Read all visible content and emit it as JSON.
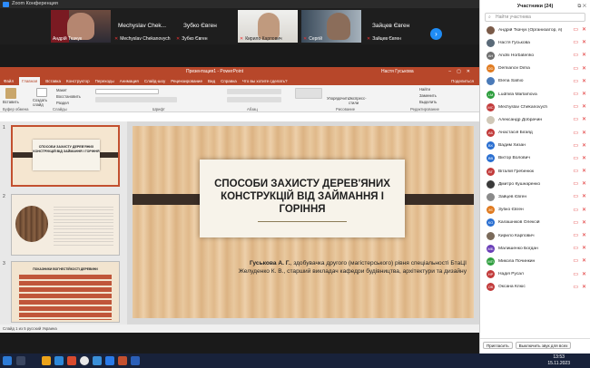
{
  "zoom": {
    "window_title": "Zoom Конференция",
    "tiles": [
      {
        "name": "Андрій Ткачук",
        "muted": false
      },
      {
        "name": "Mechyslav Chekanovych",
        "muted": true,
        "big_name": "Mechyslav  Chek..."
      },
      {
        "name": "Зубко Євген",
        "muted": true,
        "big_name": "Зубко Євген"
      },
      {
        "name": "Кирило Карпович",
        "muted": true
      },
      {
        "name": "Сергій",
        "muted": true
      },
      {
        "name": "Зайцев Євген",
        "muted": true,
        "big_name": "Зайцев Євген"
      }
    ]
  },
  "powerpoint": {
    "title_center": "Презентация1 - PowerPoint",
    "user": "Настя Гуськова",
    "tabs": [
      "Файл",
      "Главная",
      "Вставка",
      "Конструктор",
      "Переходы",
      "Анимация",
      "Слайд-шоу",
      "Рецензирование",
      "Вид",
      "Справка",
      "Что вы хотите сделать?"
    ],
    "active_tab": "Главная",
    "share": "Поделиться",
    "ribbon_groups": [
      "Буфер обмена",
      "Слайды",
      "Шрифт",
      "Абзац",
      "Рисование",
      "Редактирование"
    ],
    "ribbon_items": {
      "paste": "Вставить",
      "create_slide": "Создать слайд",
      "layout": "Макет",
      "reset": "Восстановить",
      "section": "Раздел",
      "arrange": "Упорядочить",
      "quick_styles": "Экспресс-стили",
      "find": "Найти",
      "replace": "Заменить",
      "select": "Выделить"
    },
    "slide": {
      "title": "СПОСОБИ ЗАХИСТУ ДЕРЕВ'ЯНИХ КОНСТРУКЦІЙ ВІД ЗАЙМАННЯ І ГОРІННЯ",
      "author_line1_bold": "Гуськова А. Г.",
      "author_line1_rest": ", здобувачка другого (магістерського) рівня спеціальності БтаЦІ",
      "author_line2": "Желуденко К. В., старший викладач кафедри будівництва, архітектури та дизайну"
    },
    "thumbs": [
      {
        "num": "1",
        "title": "СПОСОБИ ЗАХИСТУ ДЕРЕВ'ЯНИХ КОНСТРУКЦІЙ ВІД ЗАЙМАННЯ І ГОРІННЯ"
      },
      {
        "num": "2"
      },
      {
        "num": "3",
        "title": "ПОКАЗНИКИ ВОГНЕСТІЙКОСТІ ДЕРЕВИНИ"
      }
    ],
    "status": "Слайд 1 из 5    русский Украина"
  },
  "participants": {
    "header": "Участники (24)",
    "search_placeholder": "Найти участника",
    "list": [
      {
        "name": "Андрій Ткачук (Организатор, я)",
        "initials": "",
        "color": "#7a5a48"
      },
      {
        "name": "Настя Гуськова",
        "initials": "",
        "color": "#5a6a78"
      },
      {
        "name": "Andrii Horbatenko",
        "initials": "AH",
        "color": "#6e6e6e"
      },
      {
        "name": "Demianov Dima",
        "initials": "DD",
        "color": "#e07a1f"
      },
      {
        "name": "Elena Salnio",
        "initials": "",
        "color": "#4a7ab8"
      },
      {
        "name": "Ludmila Marlamova",
        "initials": "LM",
        "color": "#2e9e3e"
      },
      {
        "name": "Mechyslav Chekanovych",
        "initials": "MC",
        "color": "#c23b3b"
      },
      {
        "name": "Александр Добрачин",
        "initials": "",
        "color": "#d0c8b8"
      },
      {
        "name": "Анастасія Бігаяд",
        "initials": "АБ",
        "color": "#c23b3b"
      },
      {
        "name": "Вадим Хизан",
        "initials": "ВХ",
        "color": "#2a6fd1"
      },
      {
        "name": "Віктор Волович",
        "initials": "ВВ",
        "color": "#2a6fd1"
      },
      {
        "name": "Віталій Гребенюк",
        "initials": "ВГ",
        "color": "#c23b3b"
      },
      {
        "name": "Дмитро Кушнаренко",
        "initials": "",
        "color": "#3a3a3a"
      },
      {
        "name": "Зайцев Євген",
        "initials": "",
        "color": "#8a8a8a"
      },
      {
        "name": "Зубко Євген",
        "initials": "ЗЄ",
        "color": "#e07a1f"
      },
      {
        "name": "Калашніков Олексій",
        "initials": "КО",
        "color": "#2a6fd1"
      },
      {
        "name": "Кирило Карпович",
        "initials": "",
        "color": "#7a6a5a"
      },
      {
        "name": "Малишенко Богдан",
        "initials": "МБ",
        "color": "#6a3fb8"
      },
      {
        "name": "Микола Починкин",
        "initials": "МП",
        "color": "#2e9e3e"
      },
      {
        "name": "Надія Русал",
        "initials": "НР",
        "color": "#c23b3b"
      },
      {
        "name": "Оксана Клюс",
        "initials": "ОК",
        "color": "#c23b3b"
      }
    ],
    "invite_btn": "Пригласить",
    "mute_all_btn": "Выключить звук для всех"
  },
  "taskbar": {
    "time": "13:53",
    "date": "15.11.2023"
  }
}
